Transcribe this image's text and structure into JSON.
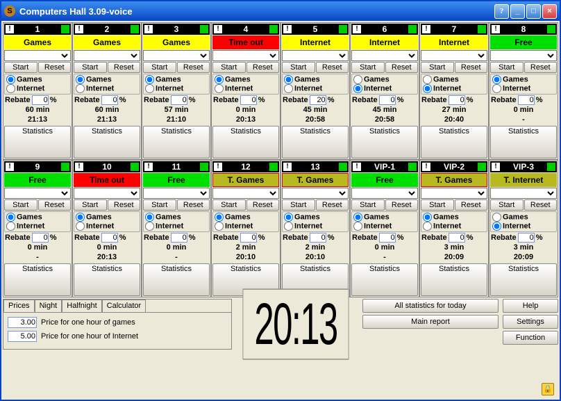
{
  "window": {
    "title": "Computers Hall 3.09-voice",
    "help": "?",
    "min": "_",
    "max": "□",
    "close": "×"
  },
  "labels": {
    "start": "Start",
    "reset": "Reset",
    "games": "Games",
    "internet": "Internet",
    "rebate": "Rebate",
    "pct": "%",
    "statistics": "Statistics"
  },
  "stations": [
    {
      "id": "1",
      "status": "Games",
      "cls": "status-games",
      "radio": "games",
      "rebate": "0",
      "dur": "60 min",
      "time": "21:13"
    },
    {
      "id": "2",
      "status": "Games",
      "cls": "status-games",
      "radio": "games",
      "rebate": "0",
      "dur": "60 min",
      "time": "21:13"
    },
    {
      "id": "3",
      "status": "Games",
      "cls": "status-games",
      "radio": "games",
      "rebate": "0",
      "dur": "57 min",
      "time": "21:10"
    },
    {
      "id": "4",
      "status": "Time out",
      "cls": "status-timeout",
      "radio": "games",
      "rebate": "0",
      "dur": "0 min",
      "time": "20:13"
    },
    {
      "id": "5",
      "status": "Internet",
      "cls": "status-internet",
      "radio": "games",
      "rebate": "20",
      "dur": "45 min",
      "time": "20:58"
    },
    {
      "id": "6",
      "status": "Internet",
      "cls": "status-internet",
      "radio": "internet",
      "rebate": "0",
      "dur": "45 min",
      "time": "20:58"
    },
    {
      "id": "7",
      "status": "Internet",
      "cls": "status-internet",
      "radio": "internet",
      "rebate": "0",
      "dur": "27 min",
      "time": "20:40"
    },
    {
      "id": "8",
      "status": "Free",
      "cls": "status-free",
      "radio": "games",
      "rebate": "0",
      "dur": "0 min",
      "time": "-"
    },
    {
      "id": "9",
      "status": "Free",
      "cls": "status-free",
      "radio": "games",
      "rebate": "0",
      "dur": "0 min",
      "time": "-"
    },
    {
      "id": "10",
      "status": "Time out",
      "cls": "status-timeout",
      "radio": "games",
      "rebate": "0",
      "dur": "0 min",
      "time": "20:13"
    },
    {
      "id": "11",
      "status": "Free",
      "cls": "status-free",
      "radio": "games",
      "rebate": "0",
      "dur": "0 min",
      "time": "-"
    },
    {
      "id": "12",
      "status": "T. Games",
      "cls": "status-tgames",
      "radio": "games",
      "rebate": "0",
      "dur": "2 min",
      "time": "20:10"
    },
    {
      "id": "13",
      "status": "T. Games",
      "cls": "status-tgames",
      "radio": "games",
      "rebate": "0",
      "dur": "2 min",
      "time": "20:10"
    },
    {
      "id": "VIP-1",
      "status": "Free",
      "cls": "status-free",
      "radio": "games",
      "rebate": "0",
      "dur": "0 min",
      "time": "-"
    },
    {
      "id": "VIP-2",
      "status": "T. Games",
      "cls": "status-tgames",
      "radio": "games",
      "rebate": "0",
      "dur": "3 min",
      "time": "20:09"
    },
    {
      "id": "VIP-3",
      "status": "T. Internet",
      "cls": "status-tinternet",
      "radio": "internet",
      "rebate": "0",
      "dur": "3 min",
      "time": "20:09"
    }
  ],
  "tabs": [
    "Prices",
    "Night",
    "Halfnight",
    "Calculator"
  ],
  "prices": {
    "games_price": "3.00",
    "games_label": "Price for one hour of games",
    "internet_price": "5.00",
    "internet_label": "Price for one hour of Internet"
  },
  "clock": "20:13",
  "buttons": {
    "all_stats": "All statistics for today",
    "main_report": "Main report",
    "help": "Help",
    "settings": "Settings",
    "function": "Function"
  },
  "lock_glyph": "🔒"
}
